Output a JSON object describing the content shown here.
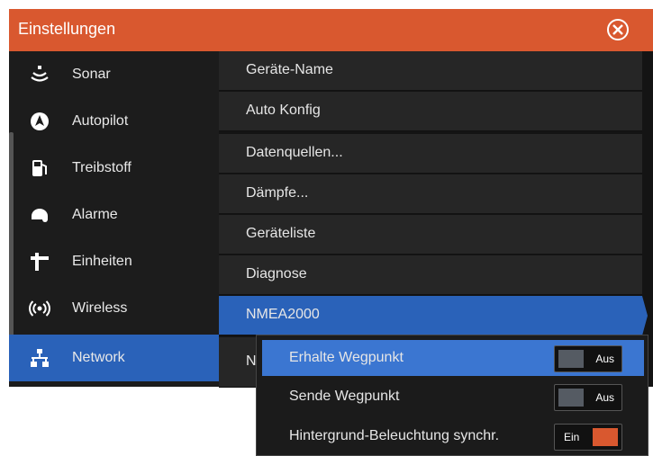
{
  "title": "Einstellungen",
  "colors": {
    "accent": "#d9582f",
    "selection": "#2a62b9"
  },
  "sidebar": {
    "items": [
      {
        "label": "Sonar",
        "icon": "sonar-icon"
      },
      {
        "label": "Autopilot",
        "icon": "autopilot-icon"
      },
      {
        "label": "Treibstoff",
        "icon": "fuel-icon"
      },
      {
        "label": "Alarme",
        "icon": "alarm-icon"
      },
      {
        "label": "Einheiten",
        "icon": "units-icon"
      },
      {
        "label": "Wireless",
        "icon": "wireless-icon"
      },
      {
        "label": "Network",
        "icon": "network-icon",
        "selected": true
      }
    ]
  },
  "network_menu": {
    "items": [
      {
        "label": "Geräte-Name"
      },
      {
        "label": "Auto Konfig"
      },
      {
        "label": "Datenquellen..."
      },
      {
        "label": "Dämpfe..."
      },
      {
        "label": "Geräteliste"
      },
      {
        "label": "Diagnose"
      },
      {
        "label": "NMEA2000",
        "selected": true
      },
      {
        "label": "N"
      }
    ]
  },
  "nmea2000_menu": {
    "items": [
      {
        "label": "Erhalte Wegpunkt",
        "state": "Aus",
        "selected": true
      },
      {
        "label": "Sende Wegpunkt",
        "state": "Aus"
      },
      {
        "label": "Hintergrund-Beleuchtung synchr.",
        "state": "Ein"
      }
    ]
  }
}
